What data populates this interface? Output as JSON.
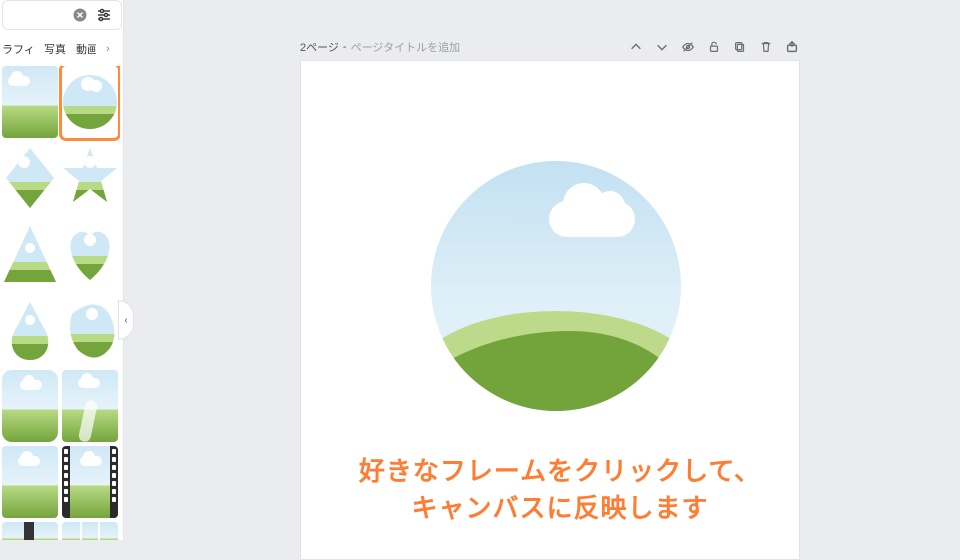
{
  "sidebar": {
    "tabs": {
      "graphic": "ラフィック",
      "photo": "写真",
      "video": "動画"
    },
    "frame_thumbs": [
      {
        "name": "frame-square",
        "selected": false
      },
      {
        "name": "frame-circle",
        "selected": true
      },
      {
        "name": "frame-diamond",
        "selected": false
      },
      {
        "name": "frame-star",
        "selected": false
      },
      {
        "name": "frame-triangle",
        "selected": false
      },
      {
        "name": "frame-heart",
        "selected": false
      },
      {
        "name": "frame-drop",
        "selected": false
      },
      {
        "name": "frame-blob",
        "selected": false
      },
      {
        "name": "frame-rounded",
        "selected": false
      },
      {
        "name": "frame-portrait",
        "selected": false
      },
      {
        "name": "frame-plain",
        "selected": false
      },
      {
        "name": "frame-film",
        "selected": false
      },
      {
        "name": "frame-polaroid",
        "selected": false
      },
      {
        "name": "frame-triptych",
        "selected": false
      }
    ]
  },
  "page": {
    "number_label": "2ページ",
    "separator": " - ",
    "title_placeholder": "ページタイトルを追加",
    "header_icons": [
      "chevron-up",
      "chevron-down",
      "eye-off",
      "lock",
      "copy",
      "trash",
      "export"
    ]
  },
  "instruction": {
    "line1": "好きなフレームをクリックして、",
    "line2": "キャンバスに反映します"
  },
  "colors": {
    "accent": "#ff7d33",
    "selection": "#ff8a3d",
    "sky_top": "#c3e1f2",
    "sky_bottom": "#e0f0f8",
    "hill_light": "#bdd98a",
    "hill_dark": "#73a43c"
  }
}
